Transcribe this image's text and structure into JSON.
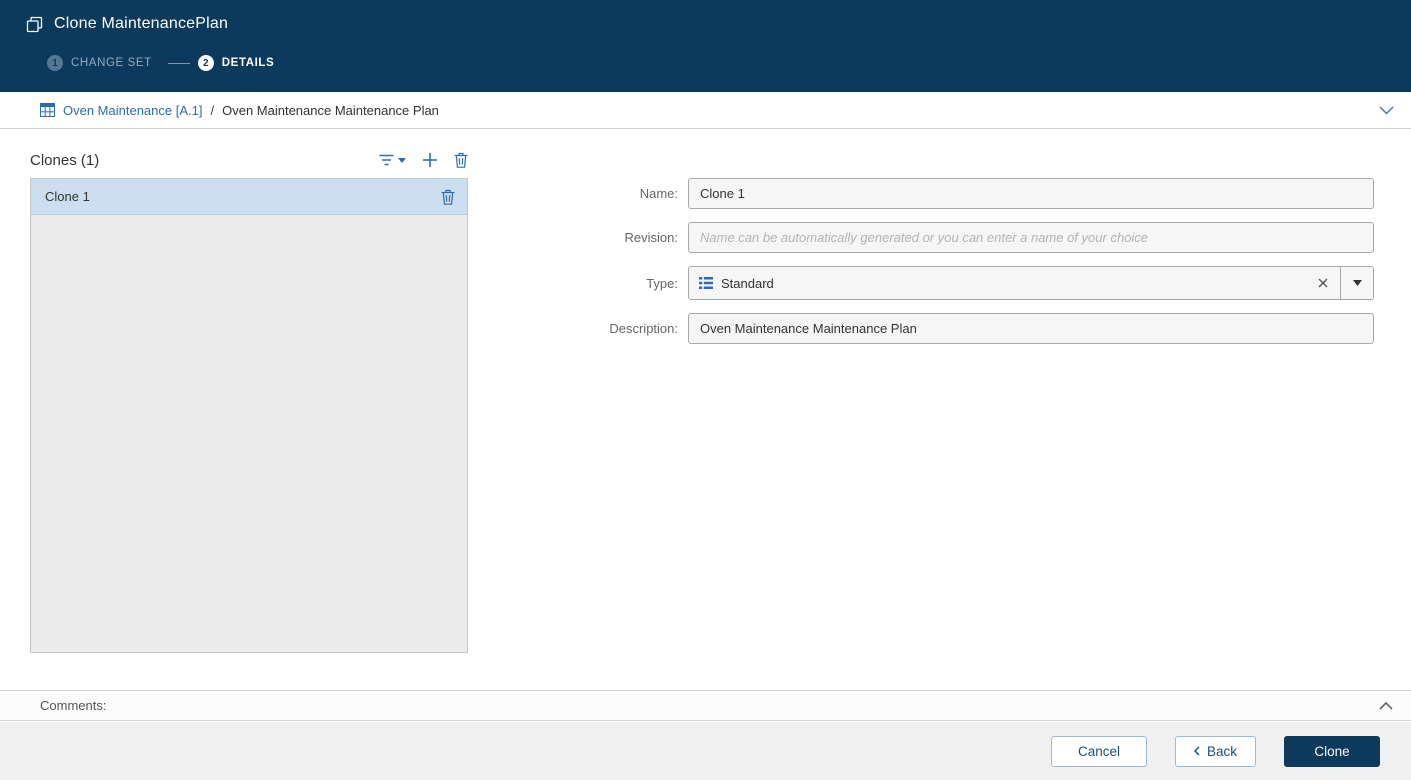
{
  "colors": {
    "header_bg": "#0b3a5d",
    "accent_blue": "#2a6db5",
    "selected_item_bg": "#cbdff0",
    "primary_button_bg": "#0b3a5d"
  },
  "header": {
    "title": "Clone MaintenancePlan",
    "steps": [
      {
        "number": "1",
        "label": "CHANGE SET",
        "state": "complete"
      },
      {
        "number": "2",
        "label": "DETAILS",
        "state": "active"
      }
    ]
  },
  "breadcrumb": {
    "parent_link": "Oven Maintenance [A.1]",
    "separator": "/",
    "current": "Oven Maintenance Maintenance Plan"
  },
  "clones_panel": {
    "title": "Clones (1)",
    "items": [
      {
        "label": "Clone 1",
        "selected": true
      }
    ]
  },
  "form": {
    "name": {
      "label": "Name:",
      "value": "Clone 1"
    },
    "revision": {
      "label": "Revision:",
      "value": "",
      "placeholder": "Name can be automatically generated or you can enter a name of your choice"
    },
    "type": {
      "label": "Type:",
      "value": "Standard"
    },
    "description": {
      "label": "Description:",
      "value": "Oven Maintenance Maintenance Plan"
    }
  },
  "comments": {
    "label": "Comments:"
  },
  "footer": {
    "cancel_label": "Cancel",
    "back_label": "Back",
    "clone_label": "Clone"
  }
}
